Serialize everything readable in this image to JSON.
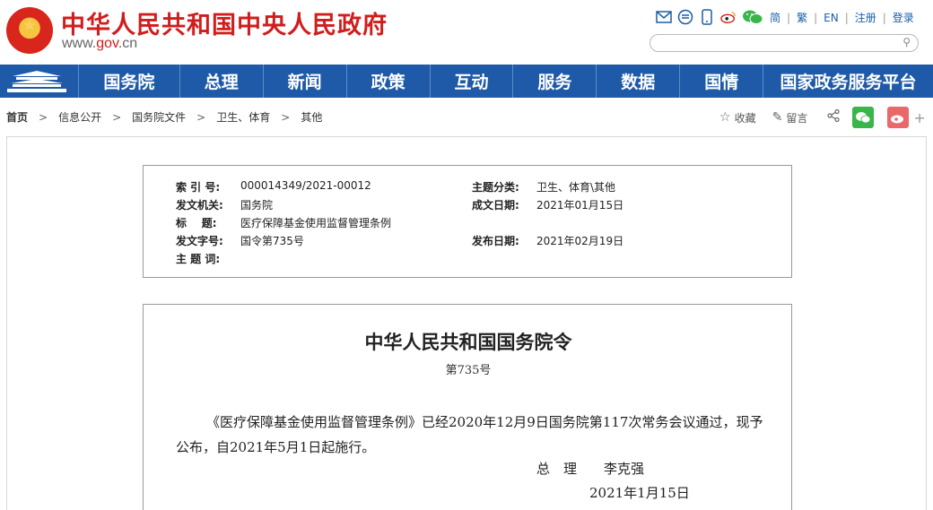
{
  "header": {
    "site_title": "中华人民共和国中央人民政府",
    "site_url_prefix": "www.",
    "site_url_gov": "gov",
    "site_url_suffix": ".cn",
    "links": {
      "simplified": "简",
      "traditional": "繁",
      "english": "EN",
      "register": "注册",
      "login": "登录"
    },
    "icons": [
      "mail-icon",
      "message-icon",
      "mobile-icon",
      "weibo-icon",
      "wechat-icon"
    ],
    "search": {
      "placeholder": "",
      "value": ""
    }
  },
  "nav": {
    "items": [
      "国务院",
      "总理",
      "新闻",
      "政策",
      "互动",
      "服务",
      "数据",
      "国情",
      "国家政务服务平台"
    ]
  },
  "breadcrumb": [
    "首页",
    "信息公开",
    "国务院文件",
    "卫生、体育",
    "其他"
  ],
  "tools": {
    "favorite": "收藏",
    "comment": "留言"
  },
  "meta": {
    "index_label": "索 引 号:",
    "index_value": "000014349/2021-00012",
    "category_label": "主题分类:",
    "category_value": "卫生、体育\\其他",
    "issuer_label": "发文机关:",
    "issuer_value": "国务院",
    "created_label": "成文日期:",
    "created_value": "2021年01月15日",
    "title_label": "标    题:",
    "title_value": "医疗保障基金使用监督管理条例",
    "docno_label": "发文字号:",
    "docno_value": "国令第735号",
    "published_label": "发布日期:",
    "published_value": "2021年02月19日",
    "keywords_label": "主 题 词:",
    "keywords_value": ""
  },
  "document": {
    "title": "中华人民共和国国务院令",
    "number": "第735号",
    "paragraph": "《医疗保障基金使用监督管理条例》已经2020年12月9日国务院第117次常务会议通过，现予公布，自2021年5月1日起施行。",
    "signature": "总　理　　李克强",
    "date": "2021年1月15日"
  },
  "colors": {
    "brand_red": "#d11d1d",
    "nav_blue": "#1e5aa8",
    "link_blue": "#1a5ea8"
  }
}
